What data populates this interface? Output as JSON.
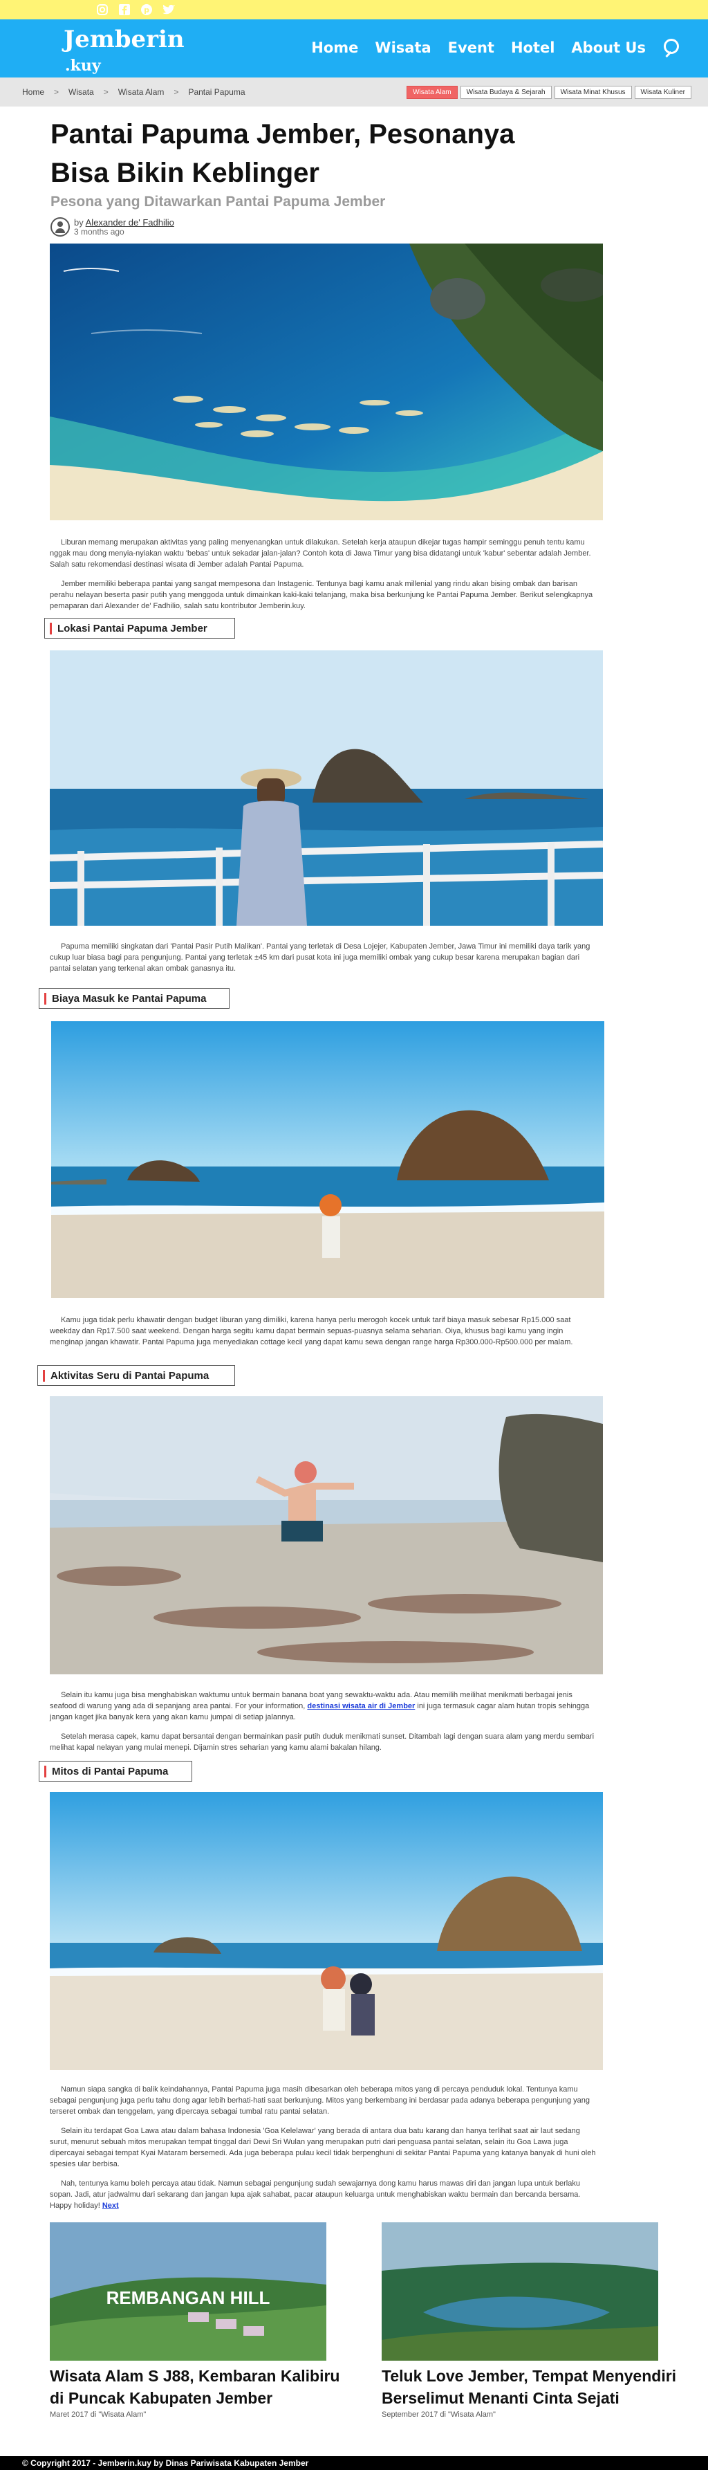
{
  "social": {
    "icons": [
      "instagram-icon",
      "facebook-icon",
      "pinterest-icon",
      "twitter-icon"
    ]
  },
  "site": {
    "logo_line1": "Jemberin",
    "logo_line2": ".kuy"
  },
  "nav": {
    "items": [
      "Home",
      "Wisata",
      "Event",
      "Hotel",
      "About Us"
    ]
  },
  "breadcrumb": {
    "items": [
      "Home",
      "Wisata",
      "Wisata Alam",
      "Pantai Papuma"
    ]
  },
  "categories": [
    "Wisata Alam",
    "Wisata Budaya & Sejarah",
    "Wisata Minat Khusus",
    "Wisata Kuliner"
  ],
  "article": {
    "title": "Pantai Papuma Jember, Pesonanya Bisa Bikin Keblinger",
    "subtitle": "Pesona yang Ditawarkan Pantai Papuma Jember",
    "by": "by",
    "author": "Alexander de' Fadhilio",
    "time": "3 months ago",
    "intro": [
      "Liburan memang merupakan aktivitas yang paling menyenangkan untuk dilakukan. Setelah kerja ataupun dikejar tugas hampir seminggu penuh tentu kamu nggak mau dong menyia-nyiakan waktu 'bebas' untuk sekadar jalan-jalan? Contoh kota di Jawa Timur yang bisa didatangi untuk 'kabur' sebentar adalah Jember. Salah satu rekomendasi destinasi wisata di Jember adalah Pantai Papuma.",
      "Jember memiliki beberapa pantai yang sangat mempesona dan Instagenic. Tentunya bagi kamu anak millenial yang rindu akan bising ombak dan barisan perahu nelayan beserta pasir putih yang menggoda untuk dimainkan kaki-kaki telanjang, maka bisa berkunjung ke Pantai Papuma Jember. Berikut selengkapnya pemaparan dari Alexander de' Fadhilio, salah satu kontributor Jemberin.kuy."
    ],
    "sections": [
      {
        "heading": "Lokasi Pantai Papuma Jember",
        "paragraphs": [
          "Papuma memiliki singkatan dari 'Pantai Pasir Putih Malikan'. Pantai yang terletak di Desa Lojejer, Kabupaten Jember, Jawa Timur ini memiliki daya tarik yang cukup luar biasa bagi para pengunjung. Pantai yang terletak ±45 km dari pusat kota ini juga memiliki ombak yang cukup besar karena merupakan bagian dari pantai selatan yang terkenal akan ombak ganasnya itu."
        ]
      },
      {
        "heading": "Biaya Masuk ke Pantai Papuma",
        "paragraphs": [
          "Kamu juga tidak perlu khawatir dengan  budget liburan yang dimiliki, karena hanya perlu merogoh kocek untuk tarif biaya masuk sebesar Rp15.000 saat weekday dan Rp17.500 saat weekend. Dengan harga segitu kamu dapat bermain sepuas-puasnya selama seharian. Oiya, khusus bagi kamu yang ingin menginap jangan khawatir. Pantai Papuma juga menyediakan cottage kecil yang dapat kamu sewa dengan range harga Rp300.000-Rp500.000 per malam."
        ]
      },
      {
        "heading": "Aktivitas Seru di Pantai Papuma",
        "paragraphs": [
          "Selain itu kamu juga bisa menghabiskan waktumu untuk bermain banana boat yang sewaktu-waktu ada. Atau memilih meilihat menikmati berbagai jenis seafood di warung yang ada di sepanjang area pantai. For your information, ",
          "Setelah merasa capek, kamu dapat bersantai dengan bermainkan pasir putih duduk menikmati sunset. Ditambah lagi dengan suara alam yang merdu sembari melihat kapal nelayan yang mulai menepi. Dijamin stres seharian yang kamu alami bakalan hilang."
        ],
        "link_text": "destinasi wisata air di Jember",
        "after_link": " ini juga termasuk cagar alam hutan tropis sehingga jangan kaget jika banyak kera yang akan kamu jumpai di setiap jalannya."
      },
      {
        "heading": "Mitos di Pantai Papuma",
        "paragraphs": [
          "Namun siapa sangka di balik keindahannya, Pantai Papuma juga masih dibesarkan oleh beberapa mitos yang di percaya penduduk lokal. Tentunya kamu sebagai pengunjung juga perlu tahu dong agar lebih berhati-hati saat berkunjung. Mitos yang berkembang ini berdasar pada adanya beberapa pengunjung yang terseret ombak dan tenggelam, yang dipercaya sebagai tumbal ratu pantai selatan.",
          "Selain itu terdapat Goa Lawa atau dalam bahasa Indonesia 'Goa Kelelawar' yang berada di antara dua batu karang dan hanya terlihat saat air laut sedang surut, menurut sebuah mitos merupakan tempat tinggal dari Dewi Sri Wulan yang merupakan putri dari penguasa pantai selatan, selain itu Goa Lawa juga dipercayai sebagai tempat Kyai Mataram bersemedi. Ada juga beberapa pulau kecil tidak berpenghuni di sekitar Pantai Papuma yang katanya banyak di huni oleh spesies ular berbisa.",
          "Nah, tentunya kamu boleh percaya atau tidak. Namun sebagai pengunjung sudah sewajarnya dong kamu harus mawas diri dan jangan lupa untuk berlaku sopan. Jadi, atur jadwalmu dari sekarang dan jangan lupa ajak sahabat, pacar ataupun keluarga untuk menghabiskan waktu bermain dan bercanda bersama. Happy holiday! "
        ],
        "next_link": "Next"
      }
    ]
  },
  "related": [
    {
      "image_caption": "REMBANGAN HILL",
      "title": "Wisata Alam S J88, Kembaran Kalibiru di Puncak Kabupaten Jember",
      "meta": "Maret 2017 di \"Wisata Alam\""
    },
    {
      "image_caption": "",
      "title": "Teluk Love Jember, Tempat Menyendiri Berselimut Menanti Cinta Sejati",
      "meta": "September 2017 di \"Wisata Alam\""
    }
  ],
  "footer": {
    "text": "© Copyright 2017 - Jemberin.kuy by Dinas Pariwisata Kabupaten Jember"
  },
  "colors": {
    "topstrip": "#fff475",
    "navbar": "#1faef4",
    "accent": "#e34040",
    "footer": "#000000"
  }
}
